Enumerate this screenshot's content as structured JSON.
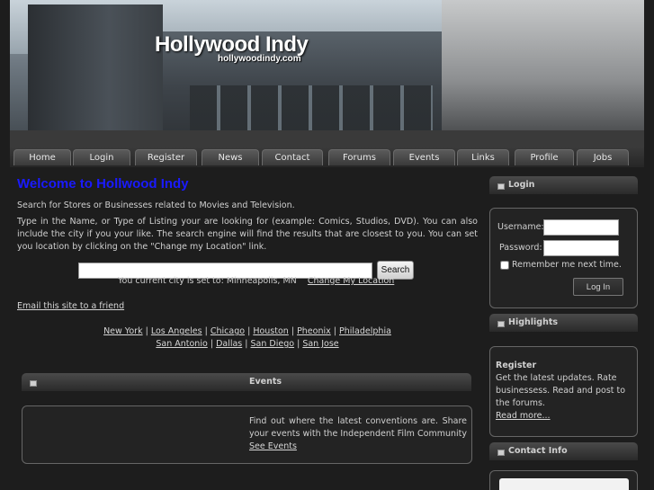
{
  "header": {
    "site_title": "Hollywood Indy",
    "site_url": "hollywoodindy.com"
  },
  "nav": {
    "items": [
      {
        "label": "Home"
      },
      {
        "label": "Login"
      },
      {
        "label": "Register"
      },
      {
        "label": "News"
      },
      {
        "label": "Contact"
      },
      {
        "label": "Forums"
      },
      {
        "label": "Events"
      },
      {
        "label": "Links"
      },
      {
        "label": "Profile"
      },
      {
        "label": "Jobs"
      }
    ]
  },
  "main": {
    "welcome_title": "Welcome to Hollwood Indy",
    "intro": "Search for Stores or Businesses related to Movies and Television.",
    "instructions": "Type in the Name, or Type of Listing your are looking for (example: Comics, Studios, DVD).  You can also include the city if you your like.  The search engine will find the results that are closest to you.  You can set you location by clicking on the \"Change my Location\" link.",
    "search": {
      "value": "",
      "button_label": "Search"
    },
    "city_text": "You current city is set to: Minneapolis, MN",
    "change_location_link": "Change My Location",
    "email_link": "Email this site to a friend",
    "cities_row1": [
      "New York",
      "Los Angeles",
      "Chicago",
      "Houston",
      "Pheonix",
      "Philadelphia"
    ],
    "cities_row2": [
      "San Antonio",
      "Dallas",
      "San Diego",
      "San Jose"
    ],
    "city_separator": "|",
    "events": {
      "title": "Events",
      "text": "Find out where the latest conventions are. Share your events with the Independent Film Community",
      "link": "See Events"
    }
  },
  "sidebar": {
    "login": {
      "title": "Login",
      "username_label": "Username:",
      "username_value": "",
      "password_label": "Password:",
      "password_value": "",
      "remember_label": "Remember me next time.",
      "button_label": "Log In"
    },
    "highlights": {
      "title": "Highlights",
      "item_title": "Register",
      "item_text": "Get the latest updates.  Rate businessess. Read and post to the forums.",
      "item_link": "Read more..."
    },
    "contact": {
      "title": "Contact Info"
    }
  },
  "colors": {
    "background": "#1d1d1d",
    "welcome_title": "#1a1aff",
    "text": "#d0d0d0"
  }
}
